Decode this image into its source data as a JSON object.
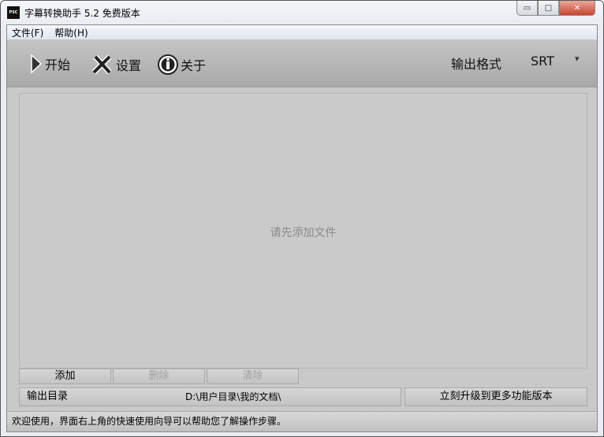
{
  "window": {
    "icon_text": "PSC",
    "title": "字幕转换助手 5.2 免费版本",
    "minimize": "▭",
    "maximize": "□",
    "close": "✕"
  },
  "menu": [
    {
      "label": "文件(F)"
    },
    {
      "label": "帮助(H)"
    }
  ],
  "toolbar": {
    "start": "开始",
    "settings": "设置",
    "about": "关于",
    "format_label": "输出格式",
    "format_value": "SRT",
    "dropdown": "▾"
  },
  "list": {
    "placeholder": "请先添加文件"
  },
  "buttons": {
    "add": "添加",
    "delete": "删除",
    "clear": "清除"
  },
  "output": {
    "label": "输出目录",
    "path": "D:\\用户目录\\我的文档\\",
    "upgrade": "立刻升级到更多功能版本"
  },
  "status": "欢迎使用，界面右上角的快速使用向导可以帮助您了解操作步骤。"
}
